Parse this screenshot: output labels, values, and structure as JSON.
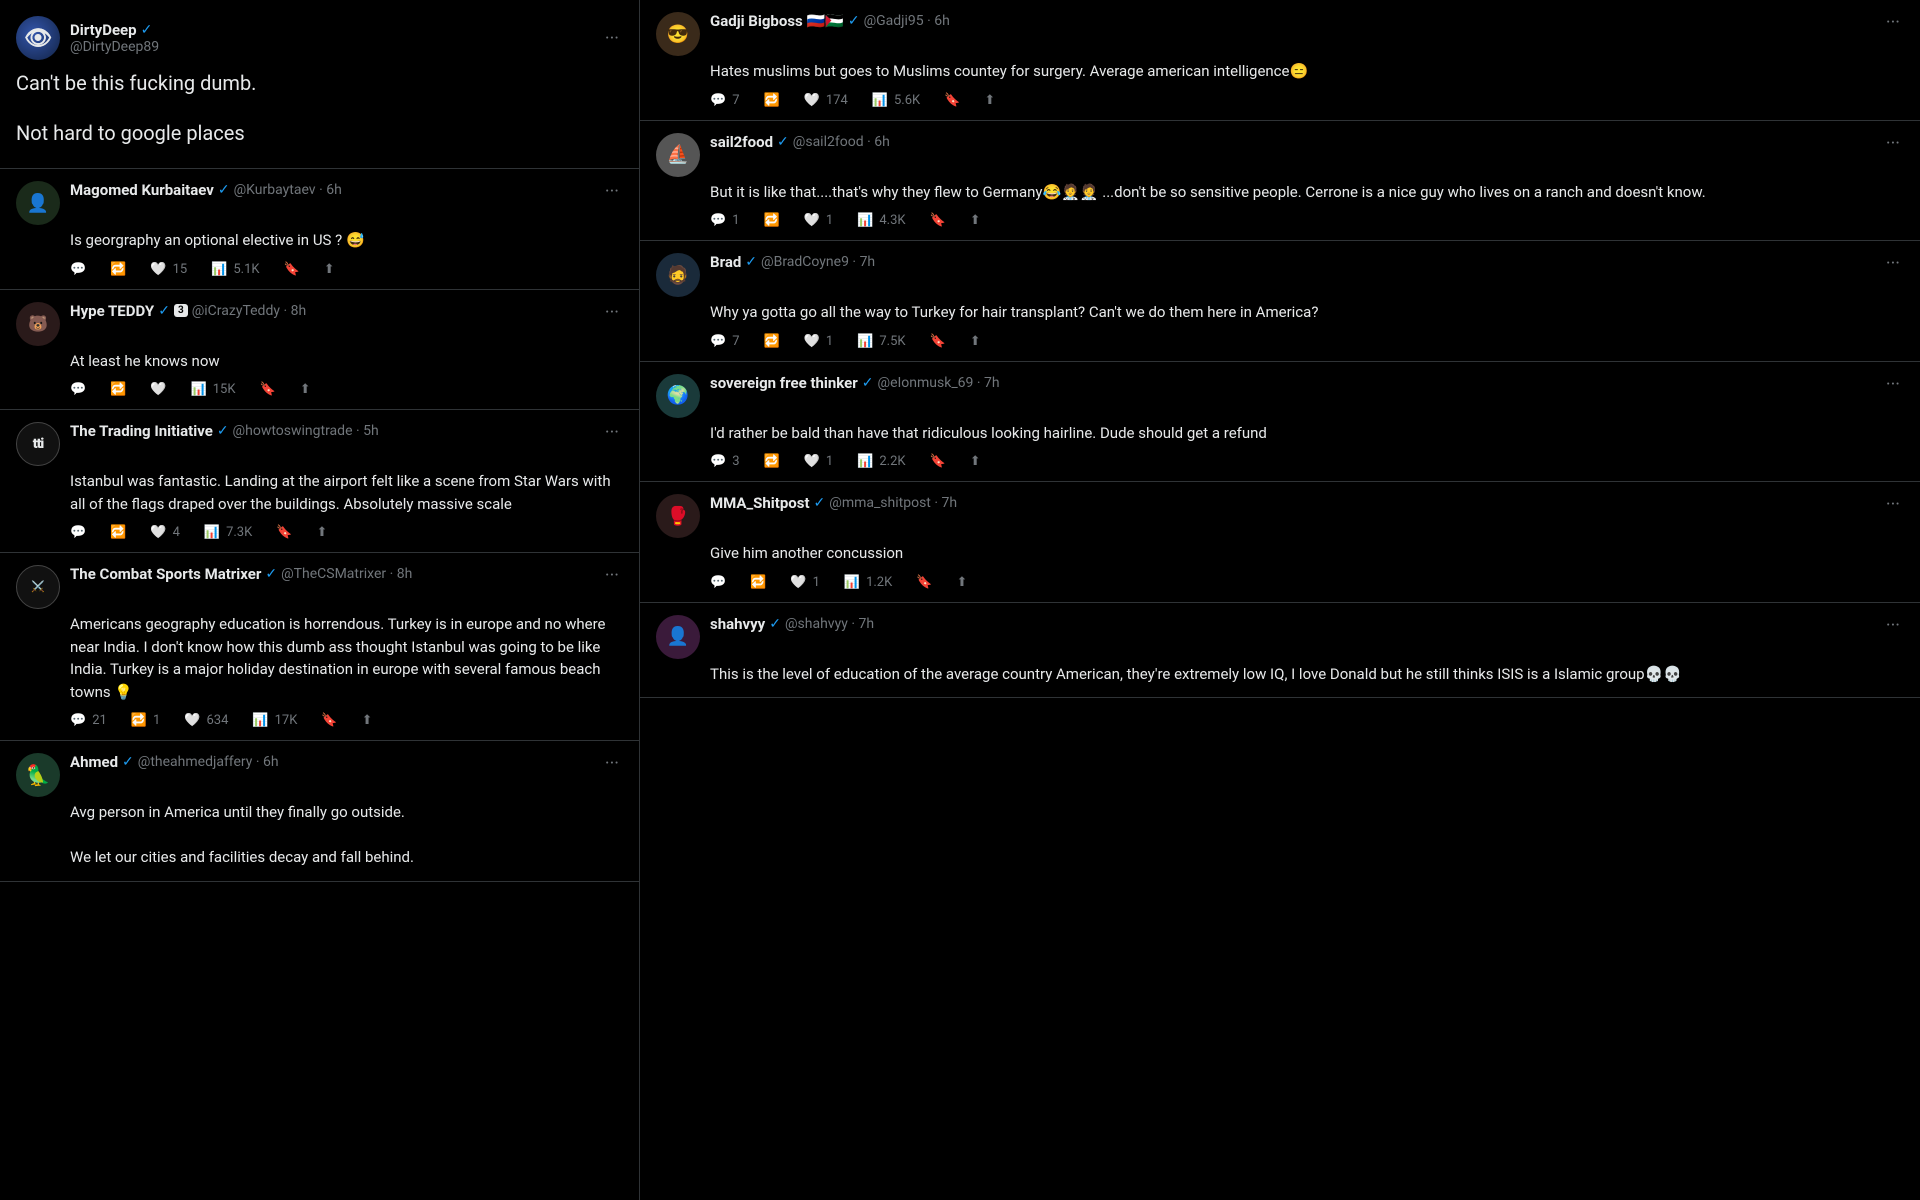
{
  "leftCol": {
    "topTweet": {
      "username": "DirtyDeep",
      "handle": "@DirtyDeep89",
      "verified": true,
      "text1": "Can't be this fucking dumb.",
      "text2": "Not hard to google places"
    },
    "tweets": [
      {
        "id": "magomed",
        "username": "Magomed Kurbaitaev",
        "verified": true,
        "handle": "@Kurbaytaev",
        "time": "6h",
        "text": "Is georgraphy an optional elective in US ? 😅",
        "replies": "",
        "retweets": "",
        "likes": "15",
        "views": "5.1K"
      },
      {
        "id": "hype",
        "username": "Hype TEDDY",
        "verified": true,
        "badge": "3",
        "handle": "@iCrazyTeddy",
        "time": "8h",
        "text": "At least he knows now",
        "replies": "",
        "retweets": "",
        "likes": "",
        "views": "15K"
      },
      {
        "id": "tti",
        "username": "The Trading Initiative",
        "verified": true,
        "handle": "@howtoswingtrade",
        "time": "5h",
        "text": "Istanbul was fantastic. Landing at the airport felt like a scene from Star Wars with all of the flags draped over the buildings. Absolutely massive scale",
        "replies": "",
        "retweets": "",
        "likes": "4",
        "views": "7.3K"
      },
      {
        "id": "combatsports",
        "username": "The Combat Sports Matrixer",
        "verified": true,
        "handle": "@TheCSMatrixer",
        "time": "8h",
        "text": "Americans geography education is horrendous. Turkey is in europe and no where near India. I don't know how this dumb ass thought Istanbul was going to be like India. Turkey is a major holiday destination in europe with several famous beach towns 💡",
        "replies": "21",
        "retweets": "1",
        "likes": "634",
        "views": "17K"
      },
      {
        "id": "ahmed",
        "username": "Ahmed",
        "verified": true,
        "handle": "@theahmedjaffery",
        "time": "6h",
        "text": "Avg person in America until they finally go outside.\n\nWe let our cities and facilities decay and fall behind.",
        "replies": "",
        "retweets": "",
        "likes": "",
        "views": ""
      }
    ]
  },
  "rightCol": {
    "tweets": [
      {
        "id": "gadji",
        "username": "Gadji Bigboss",
        "flags": "🇷🇺🇵🇸",
        "verified": true,
        "handle": "@Gadji95",
        "time": "6h",
        "text": "Hates muslims but goes to Muslims countey for surgery. Average american intelligence😑",
        "replies": "7",
        "retweets": "",
        "likes": "174",
        "views": "5.6K"
      },
      {
        "id": "sail2food",
        "username": "sail2food",
        "verified": true,
        "handle": "@sail2food",
        "time": "6h",
        "text": "But it is like that....that's why they flew to Germany😂🧑‍⚕️🧑‍⚕️ ...don't be so sensitive people. Cerrone is a nice guy who lives on a ranch and doesn't know.",
        "replies": "1",
        "retweets": "",
        "likes": "1",
        "views": "4.3K"
      },
      {
        "id": "brad",
        "username": "Brad",
        "verified": true,
        "handle": "@BradCoyne9",
        "time": "7h",
        "text": "Why ya gotta go all the way to Turkey for hair transplant?  Can't we do them here in America?",
        "replies": "7",
        "retweets": "",
        "likes": "1",
        "views": "7.5K"
      },
      {
        "id": "sovereign",
        "username": "sovereign free thinker",
        "verified": true,
        "handle": "@eIonmusk_69",
        "time": "7h",
        "text": "I'd rather be bald than have that ridiculous looking hairline. Dude should get a refund",
        "replies": "3",
        "retweets": "",
        "likes": "1",
        "views": "2.2K"
      },
      {
        "id": "mma",
        "username": "MMA_Shitpost",
        "verified": true,
        "handle": "@mma_shitpost",
        "time": "7h",
        "text": "Give him another concussion",
        "replies": "",
        "retweets": "",
        "likes": "1",
        "views": "1.2K"
      },
      {
        "id": "shahvyy",
        "username": "shahvyy",
        "verified": true,
        "handle": "@shahvyy",
        "time": "7h",
        "text": "This is the level of education of the average country American, they're extremely low IQ, I love Donald but he still thinks ISIS is a Islamic group💀💀",
        "replies": "",
        "retweets": "",
        "likes": "",
        "views": ""
      }
    ]
  },
  "icons": {
    "reply": "💬",
    "retweet": "🔁",
    "like": "🤍",
    "views": "📊",
    "bookmark": "🔖",
    "share": "⬆",
    "more": "···",
    "verified": "✓"
  }
}
